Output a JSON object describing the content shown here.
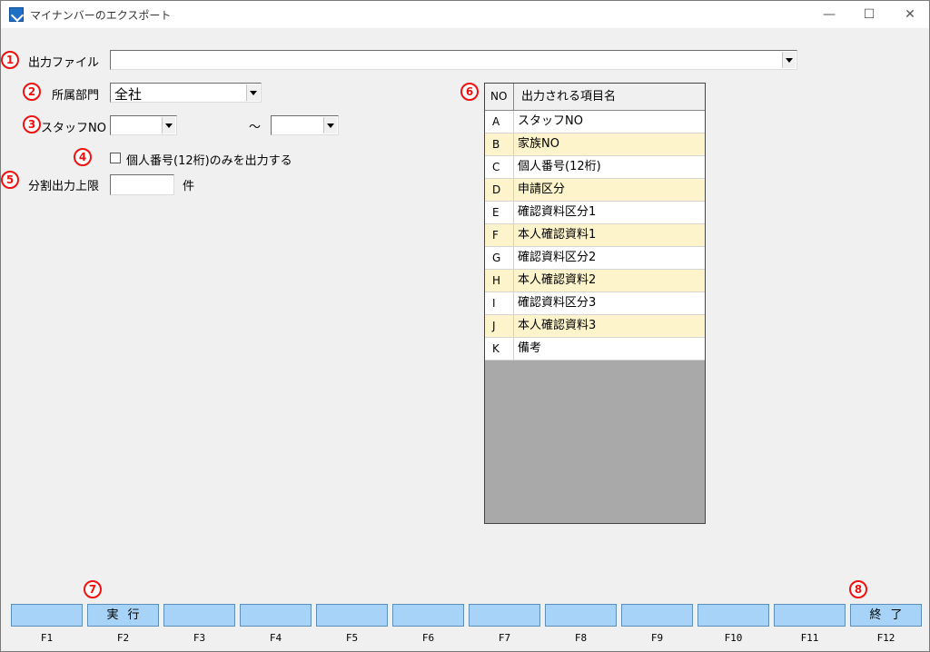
{
  "window": {
    "title": "マイナンバーのエクスポート",
    "minimize": "—",
    "maximize": "☐",
    "close": "✕"
  },
  "annotations": [
    "1",
    "2",
    "3",
    "4",
    "5",
    "6",
    "7",
    "8"
  ],
  "form": {
    "output_file_label": "出力ファイル",
    "output_file_value": "",
    "department_label": "所属部門",
    "department_value": "全社",
    "staff_no_label": "スタッフNO",
    "staff_no_from": "",
    "staff_no_to": "",
    "range_separator": "～",
    "individual_only_label": "個人番号(12桁)のみを出力する",
    "individual_only_checked": false,
    "split_limit_label": "分割出力上限",
    "split_limit_value": "",
    "split_limit_unit": "件"
  },
  "items_list": {
    "header_no": "NO",
    "header_name": "出力される項目名",
    "rows": [
      {
        "no": "A",
        "name": "スタッフNO"
      },
      {
        "no": "B",
        "name": "家族NO"
      },
      {
        "no": "C",
        "name": "個人番号(12桁)"
      },
      {
        "no": "D",
        "name": "申請区分"
      },
      {
        "no": "E",
        "name": "確認資料区分1"
      },
      {
        "no": "F",
        "name": "本人確認資料1"
      },
      {
        "no": "G",
        "name": "確認資料区分2"
      },
      {
        "no": "H",
        "name": "本人確認資料2"
      },
      {
        "no": "I",
        "name": "確認資料区分3"
      },
      {
        "no": "J",
        "name": "本人確認資料3"
      },
      {
        "no": "K",
        "name": "備考"
      }
    ]
  },
  "function_keys": [
    {
      "key": "F1",
      "label": ""
    },
    {
      "key": "F2",
      "label": "実行"
    },
    {
      "key": "F3",
      "label": ""
    },
    {
      "key": "F4",
      "label": ""
    },
    {
      "key": "F5",
      "label": ""
    },
    {
      "key": "F6",
      "label": ""
    },
    {
      "key": "F7",
      "label": ""
    },
    {
      "key": "F8",
      "label": ""
    },
    {
      "key": "F9",
      "label": ""
    },
    {
      "key": "F10",
      "label": ""
    },
    {
      "key": "F11",
      "label": ""
    },
    {
      "key": "F12",
      "label": "終了"
    }
  ],
  "colors": {
    "accent_annotation": "#ee1111",
    "fkey_bg": "#a6d3f7",
    "row_alt_bg": "#fdf4cc"
  }
}
